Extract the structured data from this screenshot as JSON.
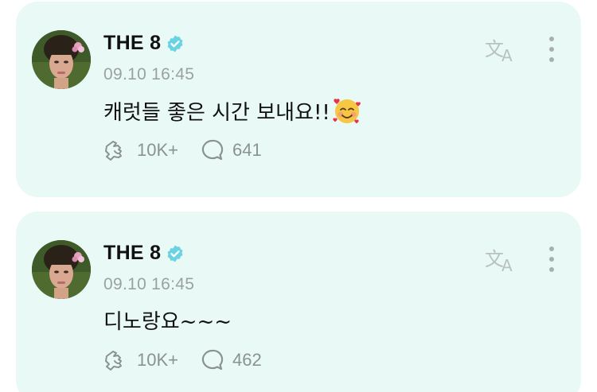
{
  "posts": [
    {
      "author": "THE 8",
      "time": "09.10 16:45",
      "text": "캐럿들 좋은 시간 보내요!!",
      "emoji": "smiling-face-with-hearts",
      "likes": "10K+",
      "comments": "641"
    },
    {
      "author": "THE 8",
      "time": "09.10 16:45",
      "text": "디노랑요~~~",
      "emoji": "",
      "likes": "10K+",
      "comments": "462"
    }
  ],
  "icons": {
    "verified": "verified-badge-icon",
    "translate": "translate-icon",
    "more": "more-vertical-icon",
    "like": "like-hand-icon",
    "comment": "comment-bubble-icon"
  },
  "colors": {
    "card_background": "#e9faf6",
    "verified_badge": "#6ad3e3",
    "muted_text": "#9aa1a0"
  }
}
